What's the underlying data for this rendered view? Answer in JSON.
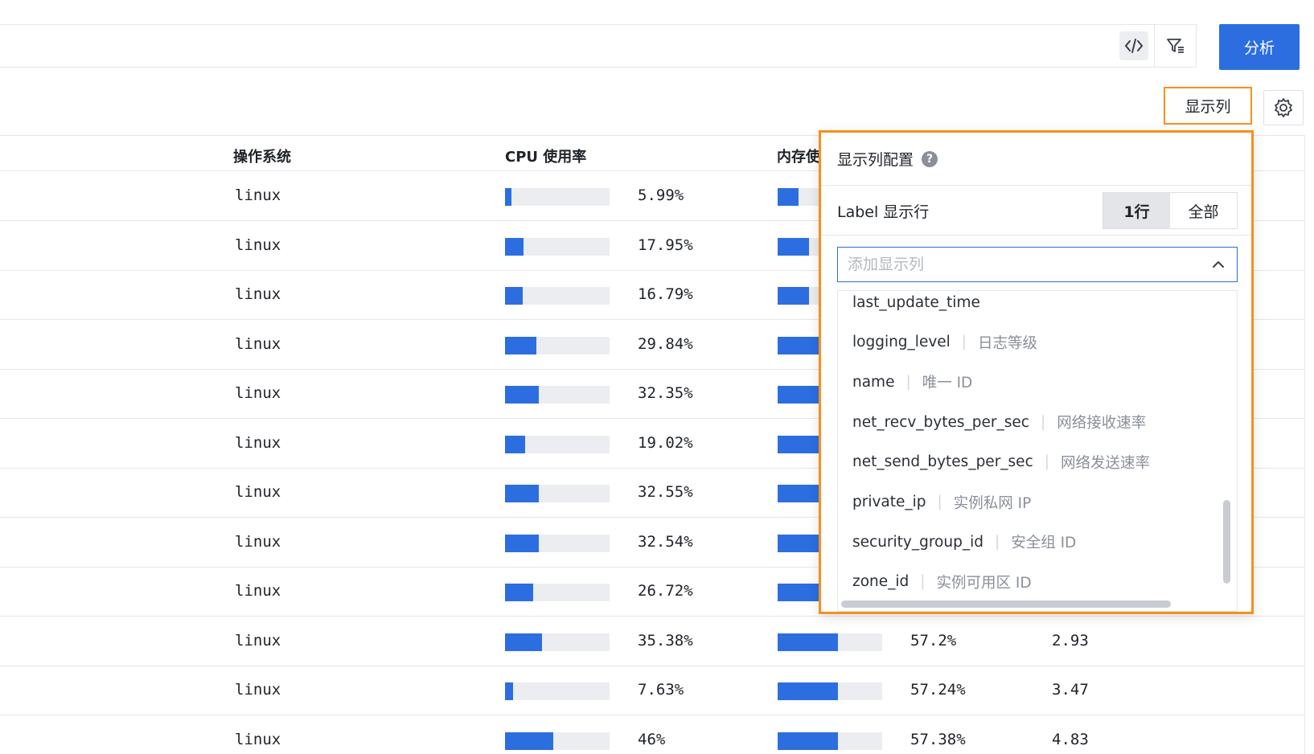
{
  "toolbar": {
    "analyze_label": "分析",
    "show_columns_label": "显示列",
    "code_icon": "code-icon",
    "filter_icon": "filter-icon",
    "settings_icon": "gear-icon"
  },
  "table": {
    "headers": {
      "os": "操作系统",
      "cpu": "CPU 使用率",
      "mem": "内存使"
    },
    "rows": [
      {
        "os": "linux",
        "cpu": 5.99,
        "cpu_label": "5.99%",
        "mem": 20.0
      },
      {
        "os": "linux",
        "cpu": 17.95,
        "cpu_label": "17.95%",
        "mem": 30.0
      },
      {
        "os": "linux",
        "cpu": 16.79,
        "cpu_label": "16.79%",
        "mem": 30.0
      },
      {
        "os": "linux",
        "cpu": 29.84,
        "cpu_label": "29.84%",
        "mem": 45.0
      },
      {
        "os": "linux",
        "cpu": 32.35,
        "cpu_label": "32.35%",
        "mem": 50.0
      },
      {
        "os": "linux",
        "cpu": 19.02,
        "cpu_label": "19.02%",
        "mem": 50.0
      },
      {
        "os": "linux",
        "cpu": 32.55,
        "cpu_label": "32.55%",
        "mem": 55.0
      },
      {
        "os": "linux",
        "cpu": 32.54,
        "cpu_label": "32.54%",
        "mem": 55.0
      },
      {
        "os": "linux",
        "cpu": 26.72,
        "cpu_label": "26.72%",
        "mem": 55.0
      },
      {
        "os": "linux",
        "cpu": 35.38,
        "cpu_label": "35.38%",
        "mem": 57.2,
        "mem_label": "57.2%",
        "extra": "2.93"
      },
      {
        "os": "linux",
        "cpu": 7.63,
        "cpu_label": "7.63%",
        "mem": 57.24,
        "mem_label": "57.24%",
        "extra": "3.47"
      },
      {
        "os": "linux",
        "cpu": 46,
        "cpu_label": "46%",
        "mem": 57.38,
        "mem_label": "57.38%",
        "extra": "4.83"
      }
    ]
  },
  "column_config": {
    "title": "显示列配置",
    "help_icon": "help-circle-icon",
    "label_rows_title": "Label 显示行",
    "segment_options": [
      "1行",
      "全部"
    ],
    "segment_selected": "1行",
    "search_placeholder": "添加显示列",
    "options": [
      {
        "key": "last_update_time",
        "desc": ""
      },
      {
        "key": "logging_level",
        "desc": "日志等级"
      },
      {
        "key": "name",
        "desc": "唯一 ID"
      },
      {
        "key": "net_recv_bytes_per_sec",
        "desc": "网络接收速率"
      },
      {
        "key": "net_send_bytes_per_sec",
        "desc": "网络发送速率"
      },
      {
        "key": "private_ip",
        "desc": "实例私网 IP"
      },
      {
        "key": "security_group_id",
        "desc": "安全组 ID"
      },
      {
        "key": "zone_id",
        "desc": "实例可用区 ID"
      }
    ]
  },
  "colors": {
    "accent": "#2c6ee0",
    "highlight": "#f5901e"
  }
}
